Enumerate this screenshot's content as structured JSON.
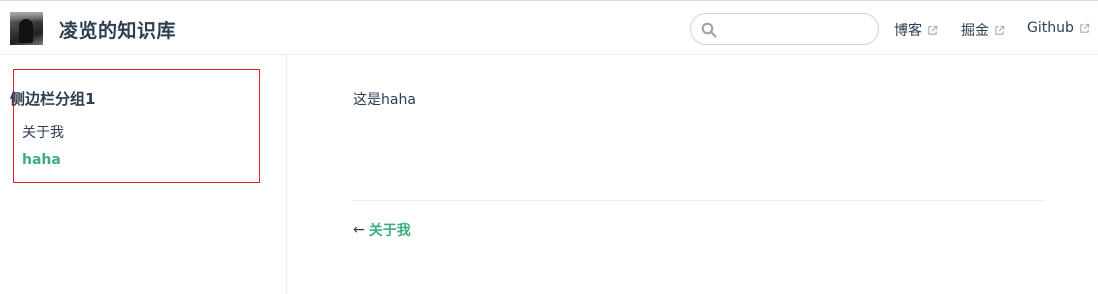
{
  "header": {
    "site_title": "凌览的知识库",
    "search": {
      "placeholder": ""
    },
    "nav": [
      {
        "label": "博客",
        "icon": "external-link-icon"
      },
      {
        "label": "掘金",
        "icon": "external-link-icon"
      },
      {
        "label": "Github",
        "icon": "external-link-icon"
      }
    ]
  },
  "sidebar": {
    "group_title": "侧边栏分组1",
    "items": [
      {
        "label": "关于我",
        "active": false
      },
      {
        "label": "haha",
        "active": true
      }
    ]
  },
  "content": {
    "text": "这是haha",
    "prev": {
      "arrow": "←",
      "label": "关于我"
    }
  },
  "colors": {
    "accent": "#3eaf7c",
    "text": "#2c3e50",
    "highlight_border": "#e0202a"
  }
}
